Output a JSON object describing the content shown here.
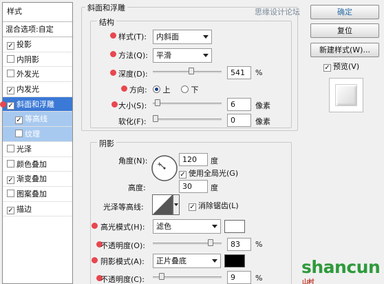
{
  "styles_panel": {
    "header": "样式",
    "blend_options": "混合选项:自定",
    "items": [
      {
        "label": "投影",
        "checked": true
      },
      {
        "label": "内阴影",
        "checked": false
      },
      {
        "label": "外发光",
        "checked": false
      },
      {
        "label": "内发光",
        "checked": true
      },
      {
        "label": "斜面和浮雕",
        "checked": true,
        "selected": true
      },
      {
        "label": "等高线",
        "checked": true,
        "sub": true
      },
      {
        "label": "纹理",
        "checked": false,
        "sub": true
      },
      {
        "label": "光泽",
        "checked": false
      },
      {
        "label": "颜色叠加",
        "checked": false
      },
      {
        "label": "渐变叠加",
        "checked": true
      },
      {
        "label": "图案叠加",
        "checked": false
      },
      {
        "label": "描边",
        "checked": true
      }
    ]
  },
  "bevel": {
    "section_title": "斜面和浮雕",
    "structure_title": "结构",
    "style_label": "样式(T):",
    "style_value": "内斜面",
    "method_label": "方法(Q):",
    "method_value": "平滑",
    "depth_label": "深度(D):",
    "depth_value": "541",
    "depth_unit": "%",
    "depth_level": 0.54,
    "direction_label": "方向:",
    "direction_up": "上",
    "direction_down": "下",
    "size_label": "大小(S):",
    "size_value": "6",
    "size_unit": "像素",
    "size_level": 0.03,
    "soften_label": "软化(F):",
    "soften_value": "0",
    "soften_unit": "像素",
    "soften_level": 0.0
  },
  "shading": {
    "title": "阴影",
    "angle_label": "角度(N):",
    "angle_value": "120",
    "angle_unit": "度",
    "global_light_label": "使用全局光(G)",
    "altitude_label": "高度:",
    "altitude_value": "30",
    "altitude_unit": "度",
    "gloss_contour_label": "光泽等高线:",
    "anti_alias_label": "消除锯齿(L)",
    "highlight_mode_label": "高光模式(H):",
    "highlight_mode_value": "滤色",
    "highlight_color": "#ffffff",
    "opacity1_label": "不透明度(O):",
    "opacity1_value": "83",
    "opacity1_level": 0.83,
    "shadow_mode_label": "阴影模式(A):",
    "shadow_mode_value": "正片叠底",
    "shadow_color": "#000000",
    "opacity2_label": "不透明度(C):",
    "opacity2_value": "9",
    "opacity2_level": 0.09,
    "percent": "%"
  },
  "buttons": {
    "ok": "确定",
    "reset": "复位",
    "new_style": "新建样式(W)...",
    "preview": "预览(V)"
  },
  "watermark": {
    "top_text": "思缘设计论坛",
    "brand": "shancun",
    "brand_sub": "山村"
  },
  "colors": {
    "selected": "#3b79d6",
    "marker": "#e8474e",
    "brand_green": "#2e9a3b"
  }
}
